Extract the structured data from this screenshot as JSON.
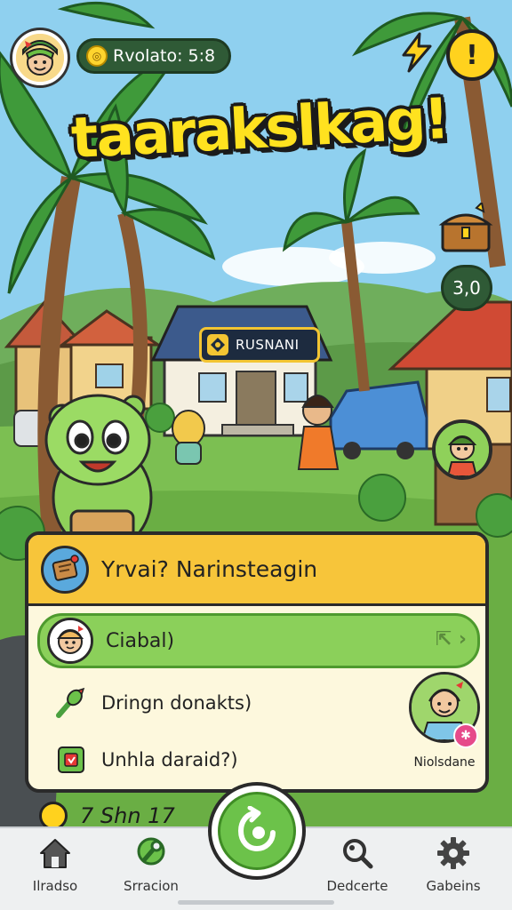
{
  "hud": {
    "status_text": "Rvolato: 5:8",
    "counter": "3,0"
  },
  "title": "taarakslkag!",
  "building_sign": "RUSNANI",
  "quest_panel": {
    "title": "Yrvai? Narinsteagin",
    "tasks": [
      {
        "label": "Ciabal)",
        "active": true
      },
      {
        "label": "Dringn donakts)",
        "active": false
      },
      {
        "label": "Unhla daraid?)",
        "active": false
      }
    ],
    "side_npc_name": "Niolsdane"
  },
  "peek_text": "7 Shn 17",
  "bottom_nav": {
    "items": [
      {
        "label": "Ilradso",
        "icon": "home-icon"
      },
      {
        "label": "Srracion",
        "icon": "wrench-icon"
      },
      {
        "label": "Dedcerte",
        "icon": "search-icon"
      },
      {
        "label": "Gabeins",
        "icon": "gear-icon"
      }
    ],
    "center_icon": "refresh-icon"
  },
  "colors": {
    "title": "#ffe21f",
    "panel_header": "#f7c53a",
    "active_task": "#8bd05a",
    "hud_pill": "#2f5a36"
  }
}
